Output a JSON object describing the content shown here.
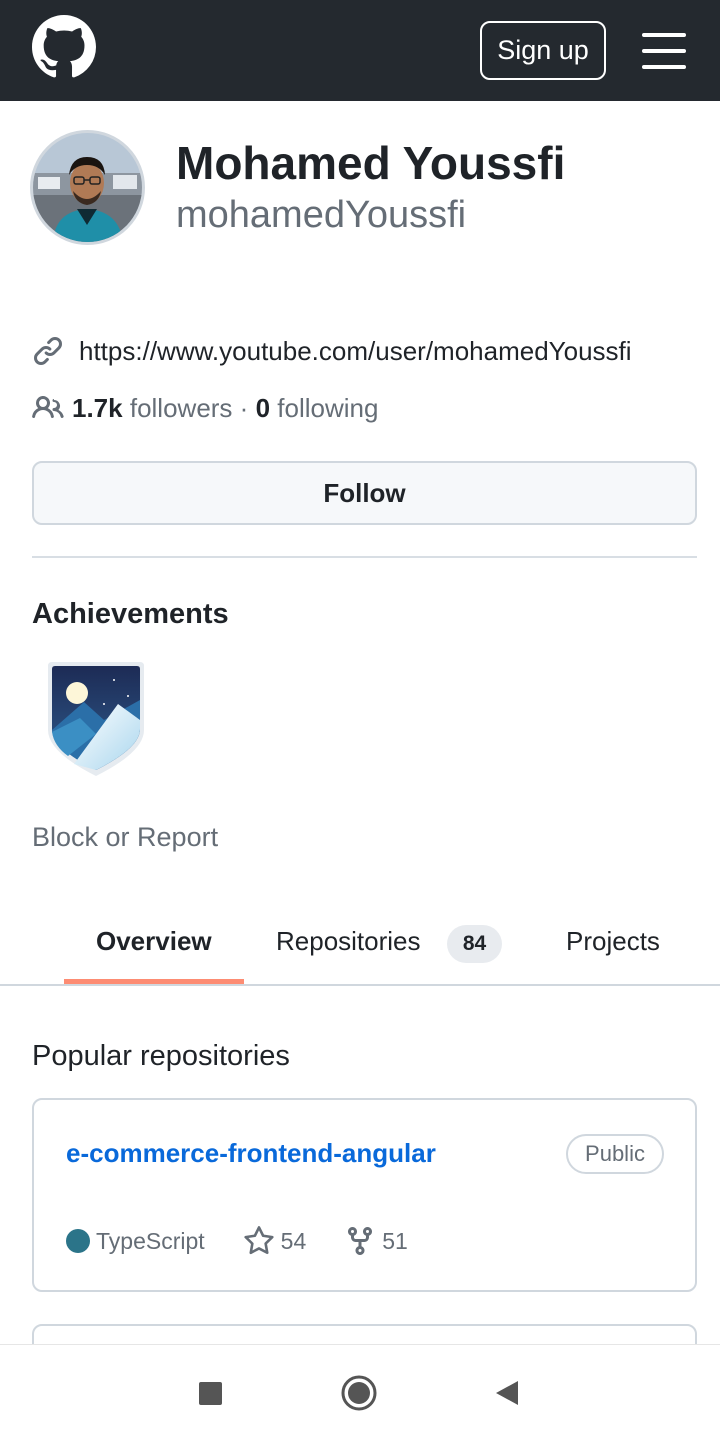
{
  "header": {
    "logo_icon": "github-octocat-icon",
    "signup_label": "Sign up",
    "menu_icon": "hamburger-menu-icon"
  },
  "profile": {
    "full_name": "Mohamed Youssfi",
    "username": "mohamedYoussfi",
    "website": "https://www.youtube.com/user/mohamedYoussfi",
    "followers_count": "1.7k",
    "followers_label": "followers",
    "separator": "·",
    "following_count": "0",
    "following_label": "following",
    "follow_button": "Follow"
  },
  "achievements": {
    "heading": "Achievements",
    "badges": [
      {
        "icon": "arctic-code-vault-badge-icon"
      }
    ]
  },
  "block_report": "Block or Report",
  "tabs": {
    "items": [
      {
        "label": "Overview",
        "selected": true
      },
      {
        "label": "Repositories",
        "counter": "84"
      },
      {
        "label": "Projects"
      }
    ]
  },
  "popular": {
    "heading": "Popular repositories",
    "repos": [
      {
        "name": "e-commerce-frontend-angular",
        "visibility": "Public",
        "language": "TypeScript",
        "language_color": "#3178c6",
        "stars": "54",
        "forks": "51"
      }
    ]
  },
  "colors": {
    "header_bg": "#24292f",
    "link": "#0969da",
    "tab_underline": "#fd8c73",
    "typescript_dot": "#2b7489"
  }
}
